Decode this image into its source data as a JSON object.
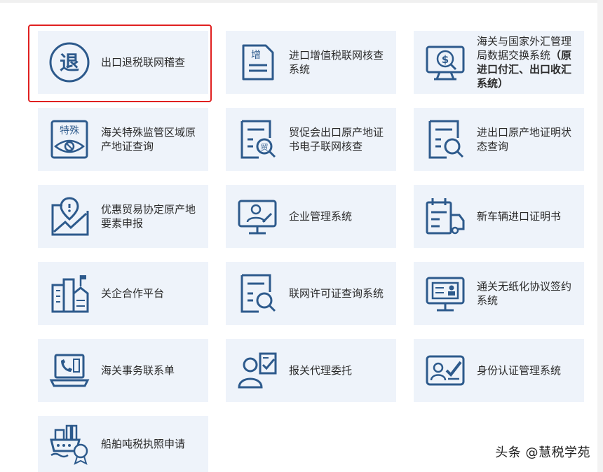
{
  "tiles": [
    {
      "label": "出口退税联网稽查",
      "icon": "refund-icon"
    },
    {
      "label": "进口增值税联网核查系统",
      "icon": "vat-document-icon"
    },
    {
      "label": "海关与国家外汇管理局数据交换系统",
      "label_bold": "（原进口付汇、出口收汇系统）",
      "icon": "forex-monitor-icon"
    },
    {
      "label": "海关特殊监管区域原产地证查询",
      "icon": "special-zone-eye-icon"
    },
    {
      "label": "贸促会出口原产地证书电子联网核查",
      "icon": "certificate-search-icon"
    },
    {
      "label": "进出口原产地证明状态查询",
      "icon": "document-search-icon"
    },
    {
      "label": "优惠贸易协定原产地要素申报",
      "icon": "location-chart-icon"
    },
    {
      "label": "企业管理系统",
      "icon": "enterprise-user-icon"
    },
    {
      "label": "新车辆进口证明书",
      "icon": "calendar-truck-icon"
    },
    {
      "label": "关企合作平台",
      "icon": "buildings-icon"
    },
    {
      "label": "联网许可证查询系统",
      "icon": "license-search-icon"
    },
    {
      "label": "通关无纸化协议签约系统",
      "icon": "id-card-monitor-icon"
    },
    {
      "label": "海关事务联系单",
      "icon": "laptop-phone-icon"
    },
    {
      "label": "报关代理委托",
      "icon": "agent-clipboard-icon"
    },
    {
      "label": "身份认证管理系统",
      "icon": "identity-check-icon"
    },
    {
      "label": "船舶吨税执照申请",
      "icon": "ship-seal-icon"
    }
  ],
  "icon_glyphs": {
    "refund": "退",
    "vat": "增",
    "zone": "特殊",
    "trade": "贸"
  },
  "watermark": "头条 @慧税学苑",
  "colors": {
    "tile_bg": "#eef3fa",
    "icon": "#2d5a8c",
    "highlight": "#e02020"
  }
}
